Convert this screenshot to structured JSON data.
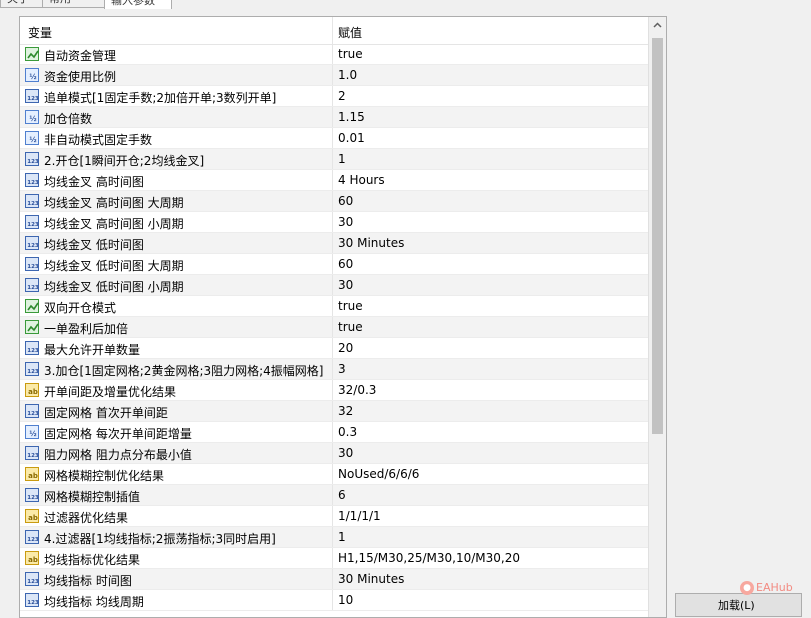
{
  "tabs": [
    "关于",
    "常用",
    "输入参数"
  ],
  "header": {
    "col1": "变量",
    "col2": "赋值"
  },
  "rows": [
    {
      "type": "bool",
      "name": "自动资金管理",
      "value": "true"
    },
    {
      "type": "dbl",
      "name": "资金使用比例",
      "value": "1.0"
    },
    {
      "type": "int",
      "name": "追单模式[1固定手数;2加倍开单;3数列开单]",
      "value": "2"
    },
    {
      "type": "dbl",
      "name": "加仓倍数",
      "value": "1.15"
    },
    {
      "type": "dbl",
      "name": "非自动模式固定手数",
      "value": "0.01"
    },
    {
      "type": "int",
      "name": "2.开仓[1瞬间开仓;2均线金叉]",
      "value": "1"
    },
    {
      "type": "int",
      "name": "均线金叉 高时间图",
      "value": "4 Hours"
    },
    {
      "type": "int",
      "name": "均线金叉 高时间图 大周期",
      "value": "60"
    },
    {
      "type": "int",
      "name": "均线金叉 高时间图 小周期",
      "value": "30"
    },
    {
      "type": "int",
      "name": "均线金叉 低时间图",
      "value": "30 Minutes"
    },
    {
      "type": "int",
      "name": "均线金叉 低时间图 大周期",
      "value": "60"
    },
    {
      "type": "int",
      "name": "均线金叉 低时间图 小周期",
      "value": "30"
    },
    {
      "type": "bool",
      "name": "双向开仓模式",
      "value": "true"
    },
    {
      "type": "bool",
      "name": "一单盈利后加倍",
      "value": "true"
    },
    {
      "type": "int",
      "name": "最大允许开单数量",
      "value": "20"
    },
    {
      "type": "int",
      "name": "3.加仓[1固定网格;2黄金网格;3阻力网格;4振幅网格]",
      "value": "3"
    },
    {
      "type": "str",
      "name": "开单间距及增量优化结果",
      "value": "32/0.3"
    },
    {
      "type": "int",
      "name": "固定网格 首次开单间距",
      "value": "32"
    },
    {
      "type": "dbl",
      "name": "固定网格 每次开单间距增量",
      "value": "0.3"
    },
    {
      "type": "int",
      "name": "阻力网格 阻力点分布最小值",
      "value": "30"
    },
    {
      "type": "str",
      "name": "网格模糊控制优化结果",
      "value": "NoUsed/6/6/6"
    },
    {
      "type": "int",
      "name": "网格模糊控制插值",
      "value": "6"
    },
    {
      "type": "str",
      "name": "过滤器优化结果",
      "value": "1/1/1/1"
    },
    {
      "type": "int",
      "name": "4.过滤器[1均线指标;2振荡指标;3同时启用]",
      "value": "1"
    },
    {
      "type": "str",
      "name": "均线指标优化结果",
      "value": "H1,15/M30,25/M30,10/M30,20"
    },
    {
      "type": "int",
      "name": "均线指标 时间图",
      "value": "30 Minutes"
    },
    {
      "type": "int",
      "name": "均线指标 均线周期",
      "value": "10"
    }
  ],
  "icon_labels": {
    "dbl": "½",
    "int": "123",
    "str": "ab"
  },
  "load_button": "加载(L)",
  "watermark": "EAHub"
}
